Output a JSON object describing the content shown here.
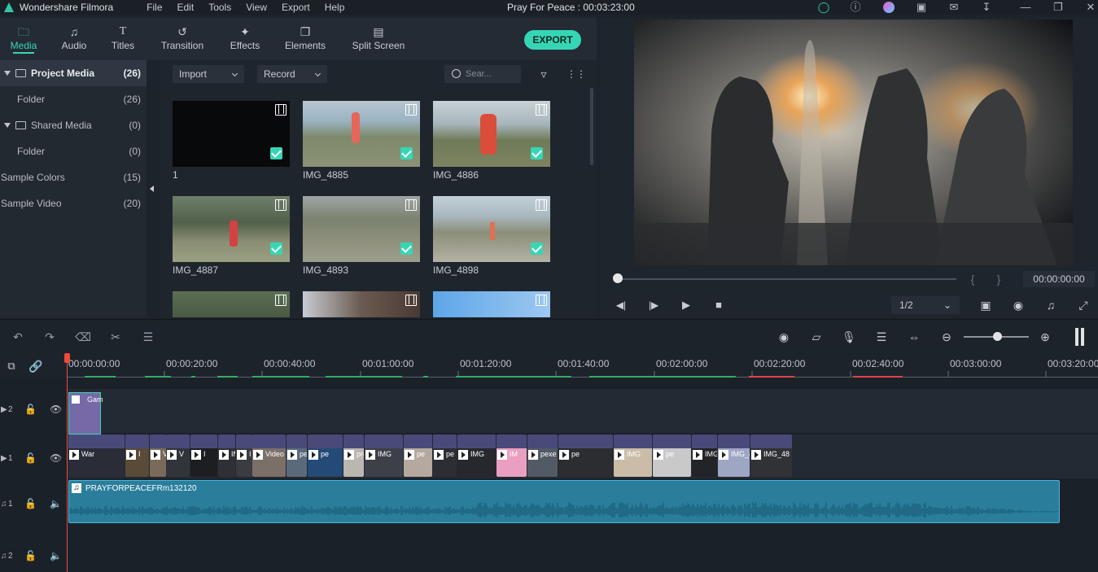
{
  "app": {
    "name": "Wondershare Filmora",
    "doc_title": "Pray For Peace : 00:03:23:00"
  },
  "menu": [
    "File",
    "Edit",
    "Tools",
    "View",
    "Export",
    "Help"
  ],
  "tabs": [
    {
      "label": "Media",
      "icon": "folder-icon",
      "active": true
    },
    {
      "label": "Audio",
      "icon": "music-note-icon"
    },
    {
      "label": "Titles",
      "icon": "text-icon"
    },
    {
      "label": "Transition",
      "icon": "transition-icon"
    },
    {
      "label": "Effects",
      "icon": "effects-icon"
    },
    {
      "label": "Elements",
      "icon": "elements-icon"
    },
    {
      "label": "Split Screen",
      "icon": "split-screen-icon"
    }
  ],
  "export_label": "EXPORT",
  "sidebar": {
    "items": [
      {
        "label": "Project Media",
        "count": "(26)"
      },
      {
        "label": "Folder",
        "count": "(26)"
      },
      {
        "label": "Shared Media",
        "count": "(0)"
      },
      {
        "label": "Folder",
        "count": "(0)"
      },
      {
        "label": "Sample Colors",
        "count": "(15)"
      },
      {
        "label": "Sample Video",
        "count": "(20)"
      }
    ]
  },
  "media": {
    "import_label": "Import",
    "record_label": "Record",
    "search_placeholder": "Sear...",
    "items": [
      {
        "name": "1"
      },
      {
        "name": "IMG_4885"
      },
      {
        "name": "IMG_4886"
      },
      {
        "name": "IMG_4887"
      },
      {
        "name": "IMG_4893"
      },
      {
        "name": "IMG_4898"
      }
    ]
  },
  "preview": {
    "timecode": "00:00:00:00",
    "ratio": "1/2",
    "brace_open": "{",
    "brace_close": "}"
  },
  "ruler": [
    "00:00:00:00",
    "00:00:20:00",
    "00:00:40:00",
    "00:01:00:00",
    "00:01:20:00",
    "00:01:40:00",
    "00:02:00:00",
    "00:02:20:00",
    "00:02:40:00",
    "00:03:00:00",
    "00:03:20:00"
  ],
  "tracks": {
    "v2_label": "2",
    "v1_label": "1",
    "a1_label": "1",
    "a2_label": "2",
    "title_clip": "Gam",
    "audio_clip": "PRAYFORPEACEFRm132120",
    "video_clips": [
      "War",
      "I",
      "V",
      "V",
      "I",
      "IMG",
      "I",
      "Video",
      "pe",
      "pe",
      "pro",
      "IMG",
      "pe",
      "pe",
      "IMG",
      "IM",
      "pexe",
      "pe",
      "IMG",
      "pe",
      "IMG_4",
      "IMG_4",
      "IMG_48"
    ]
  },
  "colors": {
    "accent": "#36d6b4",
    "clip_purple": "#4a4a7a",
    "audio": "#2a7e9c",
    "playhead": "#f04a3a"
  }
}
